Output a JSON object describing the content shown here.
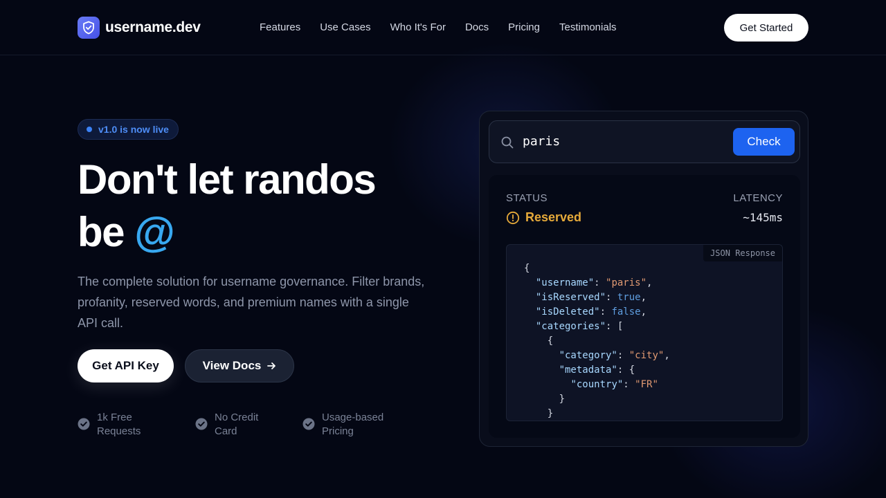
{
  "brand": {
    "name": "username.dev"
  },
  "nav": {
    "links": [
      "Features",
      "Use Cases",
      "Who It's For",
      "Docs",
      "Pricing",
      "Testimonials"
    ],
    "cta_label": "Get Started"
  },
  "hero": {
    "badge": "v1.0 is now live",
    "headline_line1": "Don't let randos",
    "headline_line2_prefix": "be ",
    "headline_at": "@",
    "description": "The complete solution for username governance. Filter brands, profanity, reserved words, and premium names with a single API call.",
    "primary_button": "Get API Key",
    "secondary_button": "View Docs",
    "features": [
      {
        "line1": "1k Free",
        "line2": "Requests"
      },
      {
        "line1": "No Credit",
        "line2": "Card"
      },
      {
        "line1": "Usage-based",
        "line2": "Pricing"
      }
    ]
  },
  "demo": {
    "search_value": "paris",
    "check_button": "Check",
    "status_label": "STATUS",
    "status_value": "Reserved",
    "latency_label": "LATENCY",
    "latency_value": "~145ms",
    "response_tag": "JSON Response",
    "response": {
      "username": "paris",
      "isReserved": "true",
      "isDeleted": "false",
      "category": "city",
      "country": "FR"
    }
  },
  "colors": {
    "background": "#040714",
    "accent_blue": "#1d63f0",
    "at_sign": "#38a8f0",
    "reserved": "#e6aa3a"
  },
  "icons": {
    "logo": "shield-check-icon",
    "search": "search-icon",
    "status": "alert-circle-icon",
    "arrow": "arrow-right-icon",
    "feature": "check-circle-icon"
  }
}
